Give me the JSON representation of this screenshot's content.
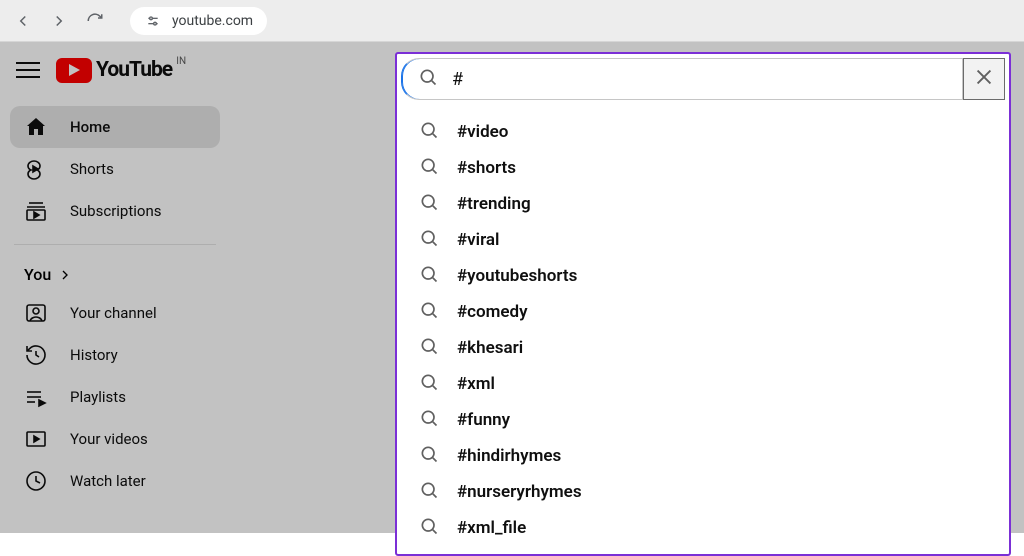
{
  "browser": {
    "url": "youtube.com"
  },
  "logo": {
    "word": "YouTube",
    "region": "IN"
  },
  "sidebar": {
    "main": [
      {
        "label": "Home"
      },
      {
        "label": "Shorts"
      },
      {
        "label": "Subscriptions"
      }
    ],
    "you_heading": "You",
    "you": [
      {
        "label": "Your channel"
      },
      {
        "label": "History"
      },
      {
        "label": "Playlists"
      },
      {
        "label": "Your videos"
      },
      {
        "label": "Watch later"
      }
    ]
  },
  "search": {
    "value": "#",
    "suggestions": [
      "#video",
      "#shorts",
      "#trending",
      "#viral",
      "#youtubeshorts",
      "#comedy",
      "#khesari",
      "#xml",
      "#funny",
      "#hindirhymes",
      "#nurseryrhymes",
      "#xml_file"
    ]
  }
}
